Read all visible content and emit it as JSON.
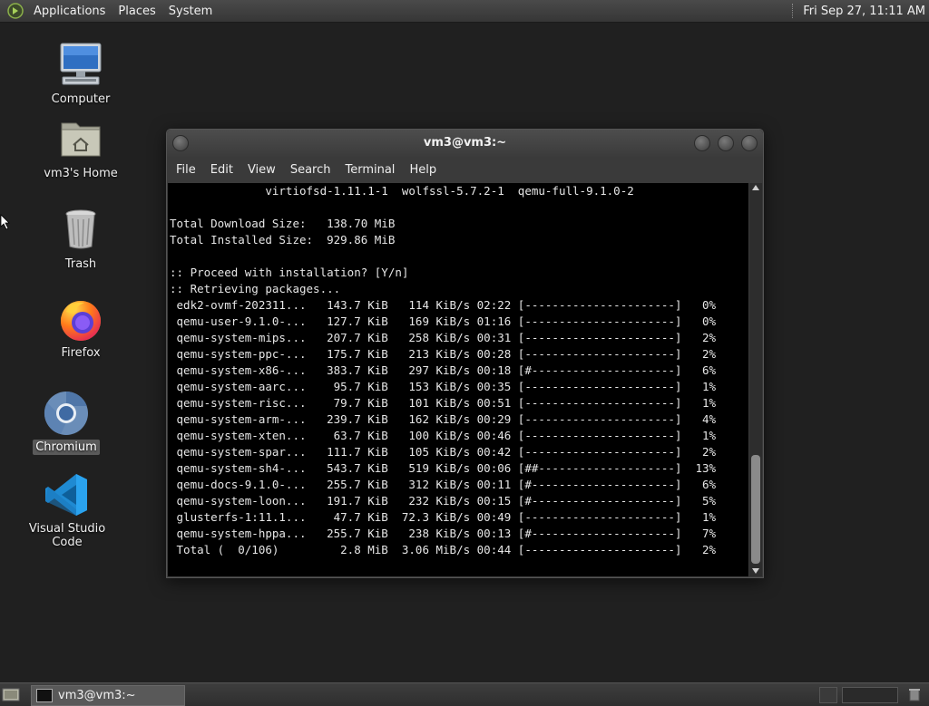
{
  "top_panel": {
    "menus": [
      "Applications",
      "Places",
      "System"
    ],
    "clock": "Fri Sep 27, 11:11 AM"
  },
  "desktop_icons": [
    {
      "label": "Computer",
      "icon": "computer-icon"
    },
    {
      "label": "vm3's Home",
      "icon": "home-folder-icon"
    },
    {
      "label": "Trash",
      "icon": "trash-icon"
    },
    {
      "label": "Firefox",
      "icon": "firefox-icon"
    },
    {
      "label": "Chromium",
      "icon": "chromium-icon",
      "selected": true
    },
    {
      "label": "Visual Studio Code",
      "icon": "vscode-icon"
    }
  ],
  "terminal": {
    "title": "vm3@vm3:~",
    "menus": [
      "File",
      "Edit",
      "View",
      "Search",
      "Terminal",
      "Help"
    ],
    "lines": [
      "              virtiofsd-1.11.1-1  wolfssl-5.7.2-1  qemu-full-9.1.0-2",
      "",
      "Total Download Size:   138.70 MiB",
      "Total Installed Size:  929.86 MiB",
      "",
      ":: Proceed with installation? [Y/n]",
      ":: Retrieving packages...",
      " edk2-ovmf-202311...   143.7 KiB   114 KiB/s 02:22 [----------------------]   0%",
      " qemu-user-9.1.0-...   127.7 KiB   169 KiB/s 01:16 [----------------------]   0%",
      " qemu-system-mips...   207.7 KiB   258 KiB/s 00:31 [----------------------]   2%",
      " qemu-system-ppc-...   175.7 KiB   213 KiB/s 00:28 [----------------------]   2%",
      " qemu-system-x86-...   383.7 KiB   297 KiB/s 00:18 [#---------------------]   6%",
      " qemu-system-aarc...    95.7 KiB   153 KiB/s 00:35 [----------------------]   1%",
      " qemu-system-risc...    79.7 KiB   101 KiB/s 00:51 [----------------------]   1%",
      " qemu-system-arm-...   239.7 KiB   162 KiB/s 00:29 [----------------------]   4%",
      " qemu-system-xten...    63.7 KiB   100 KiB/s 00:46 [----------------------]   1%",
      " qemu-system-spar...   111.7 KiB   105 KiB/s 00:42 [----------------------]   2%",
      " qemu-system-sh4-...   543.7 KiB   519 KiB/s 00:06 [##--------------------]  13%",
      " qemu-docs-9.1.0-...   255.7 KiB   312 KiB/s 00:11 [#---------------------]   6%",
      " qemu-system-loon...   191.7 KiB   232 KiB/s 00:15 [#---------------------]   5%",
      " glusterfs-1:11.1...    47.7 KiB  72.3 KiB/s 00:49 [----------------------]   1%",
      " qemu-system-hppa...   255.7 KiB   238 KiB/s 00:13 [#---------------------]   7%",
      " Total (  0/106)         2.8 MiB  3.06 MiB/s 00:44 [----------------------]   2%"
    ]
  },
  "bottom_panel": {
    "task_label": "vm3@vm3:~"
  },
  "colors": {
    "desktop_bg": "#202020",
    "terminal_bg": "#000000",
    "terminal_fg": "#e6e6e6"
  }
}
